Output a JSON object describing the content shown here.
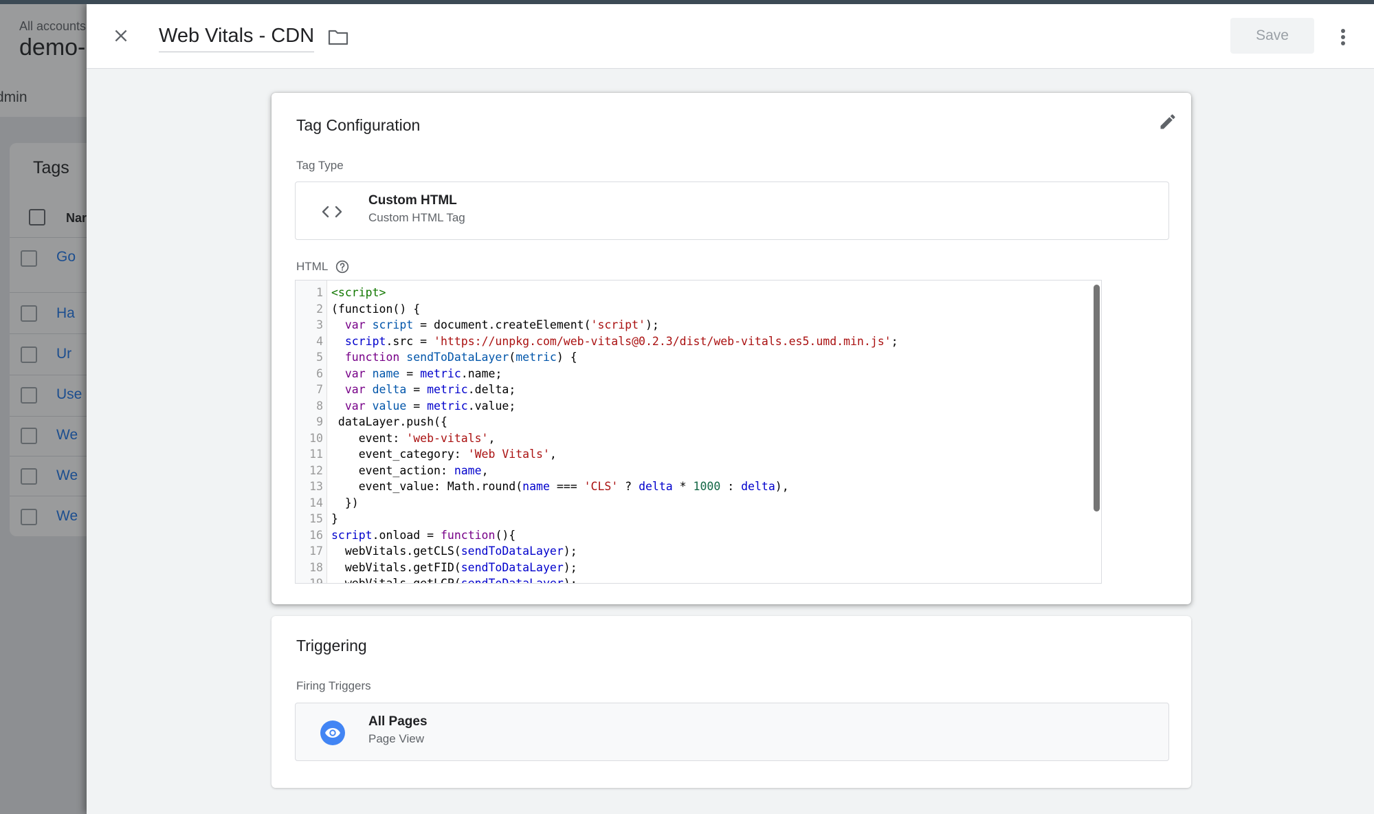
{
  "background": {
    "accounts_label": "All accounts",
    "container_name": "demo-",
    "admin_tab": "dmin",
    "tags_title": "Tags",
    "name_header": "Nar",
    "rows": [
      "Go",
      "Ha",
      "Ur",
      "Use",
      "We",
      "We",
      "We"
    ]
  },
  "header": {
    "tag_name": "Web Vitals - CDN",
    "save_label": "Save"
  },
  "config": {
    "title": "Tag Configuration",
    "tag_type_label": "Tag Type",
    "tag_type_name": "Custom HTML",
    "tag_type_sub": "Custom HTML Tag",
    "html_label": "HTML",
    "code_lines": [
      [
        [
          "tagc",
          "<script>"
        ]
      ],
      [
        [
          "plain",
          "(function() {"
        ]
      ],
      [
        [
          "plain",
          "  "
        ],
        [
          "kw",
          "var "
        ],
        [
          "def",
          "script"
        ],
        [
          "plain",
          " = document.createElement("
        ],
        [
          "str",
          "'script'"
        ],
        [
          "plain",
          ");"
        ]
      ],
      [
        [
          "plain",
          "  "
        ],
        [
          "var",
          "script"
        ],
        [
          "plain",
          ".src = "
        ],
        [
          "str",
          "'https://unpkg.com/web-vitals@0.2.3/dist/web-vitals.es5.umd.min.js'"
        ],
        [
          "plain",
          ";"
        ]
      ],
      [
        [
          "plain",
          "  "
        ],
        [
          "kw",
          "function "
        ],
        [
          "def",
          "sendToDataLayer"
        ],
        [
          "plain",
          "("
        ],
        [
          "def",
          "metric"
        ],
        [
          "plain",
          ") {"
        ]
      ],
      [
        [
          "plain",
          "  "
        ],
        [
          "kw",
          "var "
        ],
        [
          "def",
          "name"
        ],
        [
          "plain",
          " = "
        ],
        [
          "var",
          "metric"
        ],
        [
          "plain",
          ".name;"
        ]
      ],
      [
        [
          "plain",
          "  "
        ],
        [
          "kw",
          "var "
        ],
        [
          "def",
          "delta"
        ],
        [
          "plain",
          " = "
        ],
        [
          "var",
          "metric"
        ],
        [
          "plain",
          ".delta;"
        ]
      ],
      [
        [
          "plain",
          "  "
        ],
        [
          "kw",
          "var "
        ],
        [
          "def",
          "value"
        ],
        [
          "plain",
          " = "
        ],
        [
          "var",
          "metric"
        ],
        [
          "plain",
          ".value;"
        ]
      ],
      [
        [
          "plain",
          " dataLayer.push({"
        ]
      ],
      [
        [
          "plain",
          "    event: "
        ],
        [
          "str",
          "'web-vitals'"
        ],
        [
          "plain",
          ","
        ]
      ],
      [
        [
          "plain",
          "    event_category: "
        ],
        [
          "str",
          "'Web Vitals'"
        ],
        [
          "plain",
          ","
        ]
      ],
      [
        [
          "plain",
          "    event_action: "
        ],
        [
          "var",
          "name"
        ],
        [
          "plain",
          ","
        ]
      ],
      [
        [
          "plain",
          "    event_value: Math.round("
        ],
        [
          "var",
          "name"
        ],
        [
          "plain",
          " === "
        ],
        [
          "str",
          "'CLS'"
        ],
        [
          "plain",
          " ? "
        ],
        [
          "var",
          "delta"
        ],
        [
          "plain",
          " * "
        ],
        [
          "num",
          "1000"
        ],
        [
          "plain",
          " : "
        ],
        [
          "var",
          "delta"
        ],
        [
          "plain",
          "),"
        ]
      ],
      [
        [
          "plain",
          "  })"
        ]
      ],
      [
        [
          "plain",
          "}"
        ]
      ],
      [
        [
          "var",
          "script"
        ],
        [
          "plain",
          ".onload = "
        ],
        [
          "kw",
          "function"
        ],
        [
          "plain",
          "(){"
        ]
      ],
      [
        [
          "plain",
          "  webVitals.getCLS("
        ],
        [
          "var",
          "sendToDataLayer"
        ],
        [
          "plain",
          ");"
        ]
      ],
      [
        [
          "plain",
          "  webVitals.getFID("
        ],
        [
          "var",
          "sendToDataLayer"
        ],
        [
          "plain",
          ");"
        ]
      ],
      [
        [
          "plain",
          "  webVitals.getLCP("
        ],
        [
          "var",
          "sendToDataLayer"
        ],
        [
          "plain",
          ");"
        ]
      ]
    ]
  },
  "triggering": {
    "title": "Triggering",
    "firing_label": "Firing Triggers",
    "trigger_name": "All Pages",
    "trigger_type": "Page View"
  },
  "colors": {
    "accent": "#1a73e8",
    "trigger_icon": "#4285f4"
  },
  "icons": {
    "close": "close-icon",
    "folder": "folder-icon",
    "more": "more-vert-icon",
    "edit": "pencil-icon",
    "code": "code-brackets-icon",
    "help": "help-icon",
    "trigger": "eye-icon"
  }
}
